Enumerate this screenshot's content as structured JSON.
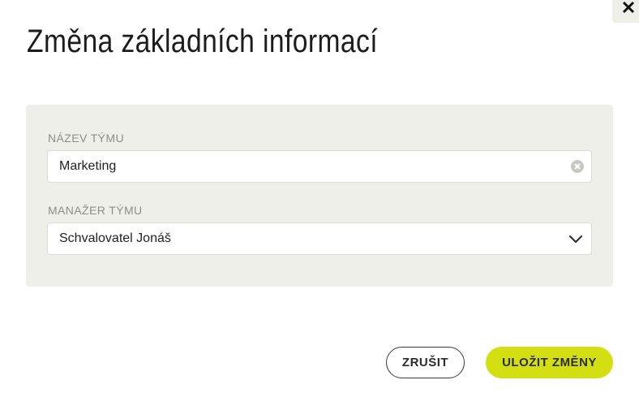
{
  "dialog": {
    "title": "Změna základních informací",
    "close_icon": "close-icon"
  },
  "form": {
    "team_name": {
      "label": "NÁZEV TÝMU",
      "value": "Marketing",
      "clear_icon": "clear-circle-icon"
    },
    "team_manager": {
      "label": "MANAŽER TÝMU",
      "selected": "Schvalovatel Jonáš",
      "dropdown_icon": "chevron-down-icon"
    }
  },
  "actions": {
    "cancel_label": "ZRUŠIT",
    "save_label": "ULOŽIT ZMĚNY"
  },
  "colors": {
    "accent": "#d4df12",
    "panel_background": "#efefea",
    "label_text": "#8e8e89",
    "body_text": "#222222"
  }
}
